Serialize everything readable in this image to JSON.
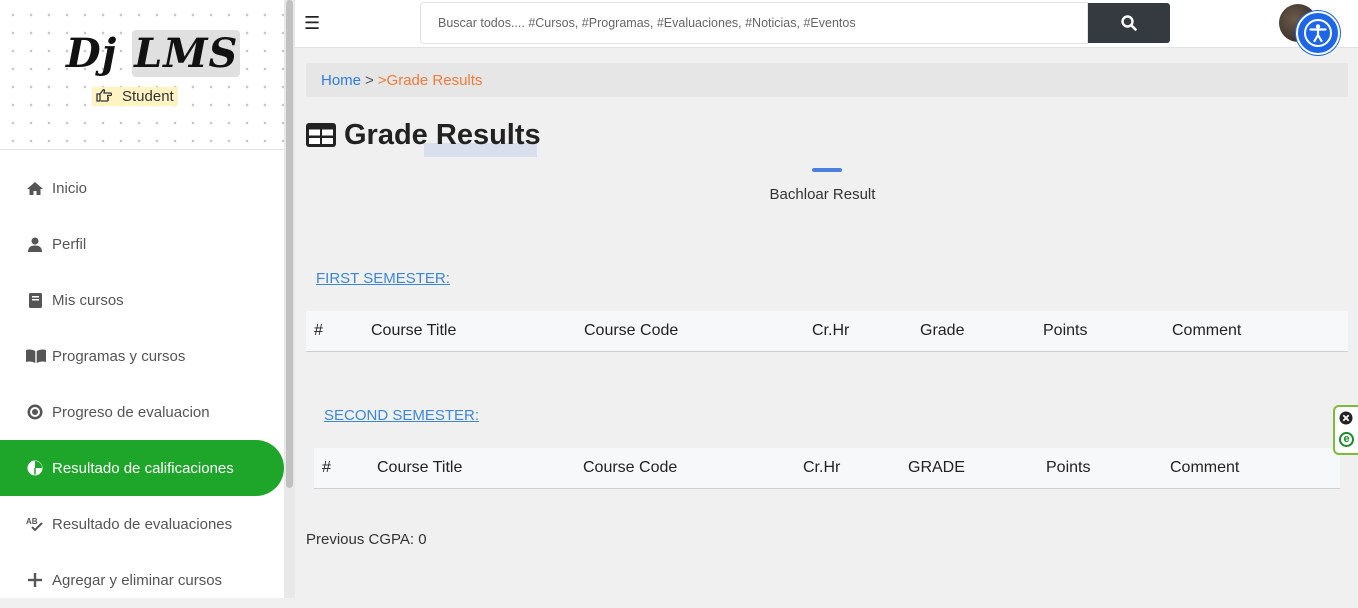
{
  "sidebar": {
    "logo_prefix": "Dj",
    "logo_main": "LMS",
    "role": "Student",
    "items": [
      {
        "label": "Inicio",
        "icon": "home-icon"
      },
      {
        "label": "Perfil",
        "icon": "user-icon"
      },
      {
        "label": "Mis cursos",
        "icon": "book-icon"
      },
      {
        "label": "Programas y cursos",
        "icon": "book-open-icon"
      },
      {
        "label": "Progreso de evaluacion",
        "icon": "target-icon"
      },
      {
        "label": "Resultado de calificaciones",
        "icon": "pie-chart-icon",
        "active": true
      },
      {
        "label": "Resultado de evaluaciones",
        "icon": "spell-check-icon"
      },
      {
        "label": "Agregar y eliminar cursos",
        "icon": "plus-icon"
      }
    ]
  },
  "topbar": {
    "menu_icon": "☰",
    "search_placeholder": "Buscar todos.... #Cursos, #Programas, #Evaluaciones, #Noticias, #Eventos"
  },
  "breadcrumb": {
    "home": "Home",
    "separator": ">",
    "current": ">Grade Results"
  },
  "page": {
    "title": "Grade Results",
    "subtitle": "Bachloar Result",
    "first_semester": {
      "label": "FIRST SEMESTER:",
      "headers": [
        "#",
        "Course Title",
        "Course Code",
        "Cr.Hr",
        "Grade",
        "Points",
        "Comment"
      ],
      "rows": []
    },
    "second_semester": {
      "label": "SECOND SEMESTER:",
      "headers": [
        "#",
        "Course Title",
        "Course Code",
        "Cr.Hr",
        "GRADE",
        "Points",
        "Comment"
      ],
      "rows": []
    },
    "cgpa_label": "Previous CGPA: 0"
  },
  "colors": {
    "active_menu": "#1ea62a",
    "link": "#2d7be5",
    "breadcrumb_current": "#f07b3a",
    "search_button": "#343a40",
    "accessibility": "#1e66e8"
  }
}
